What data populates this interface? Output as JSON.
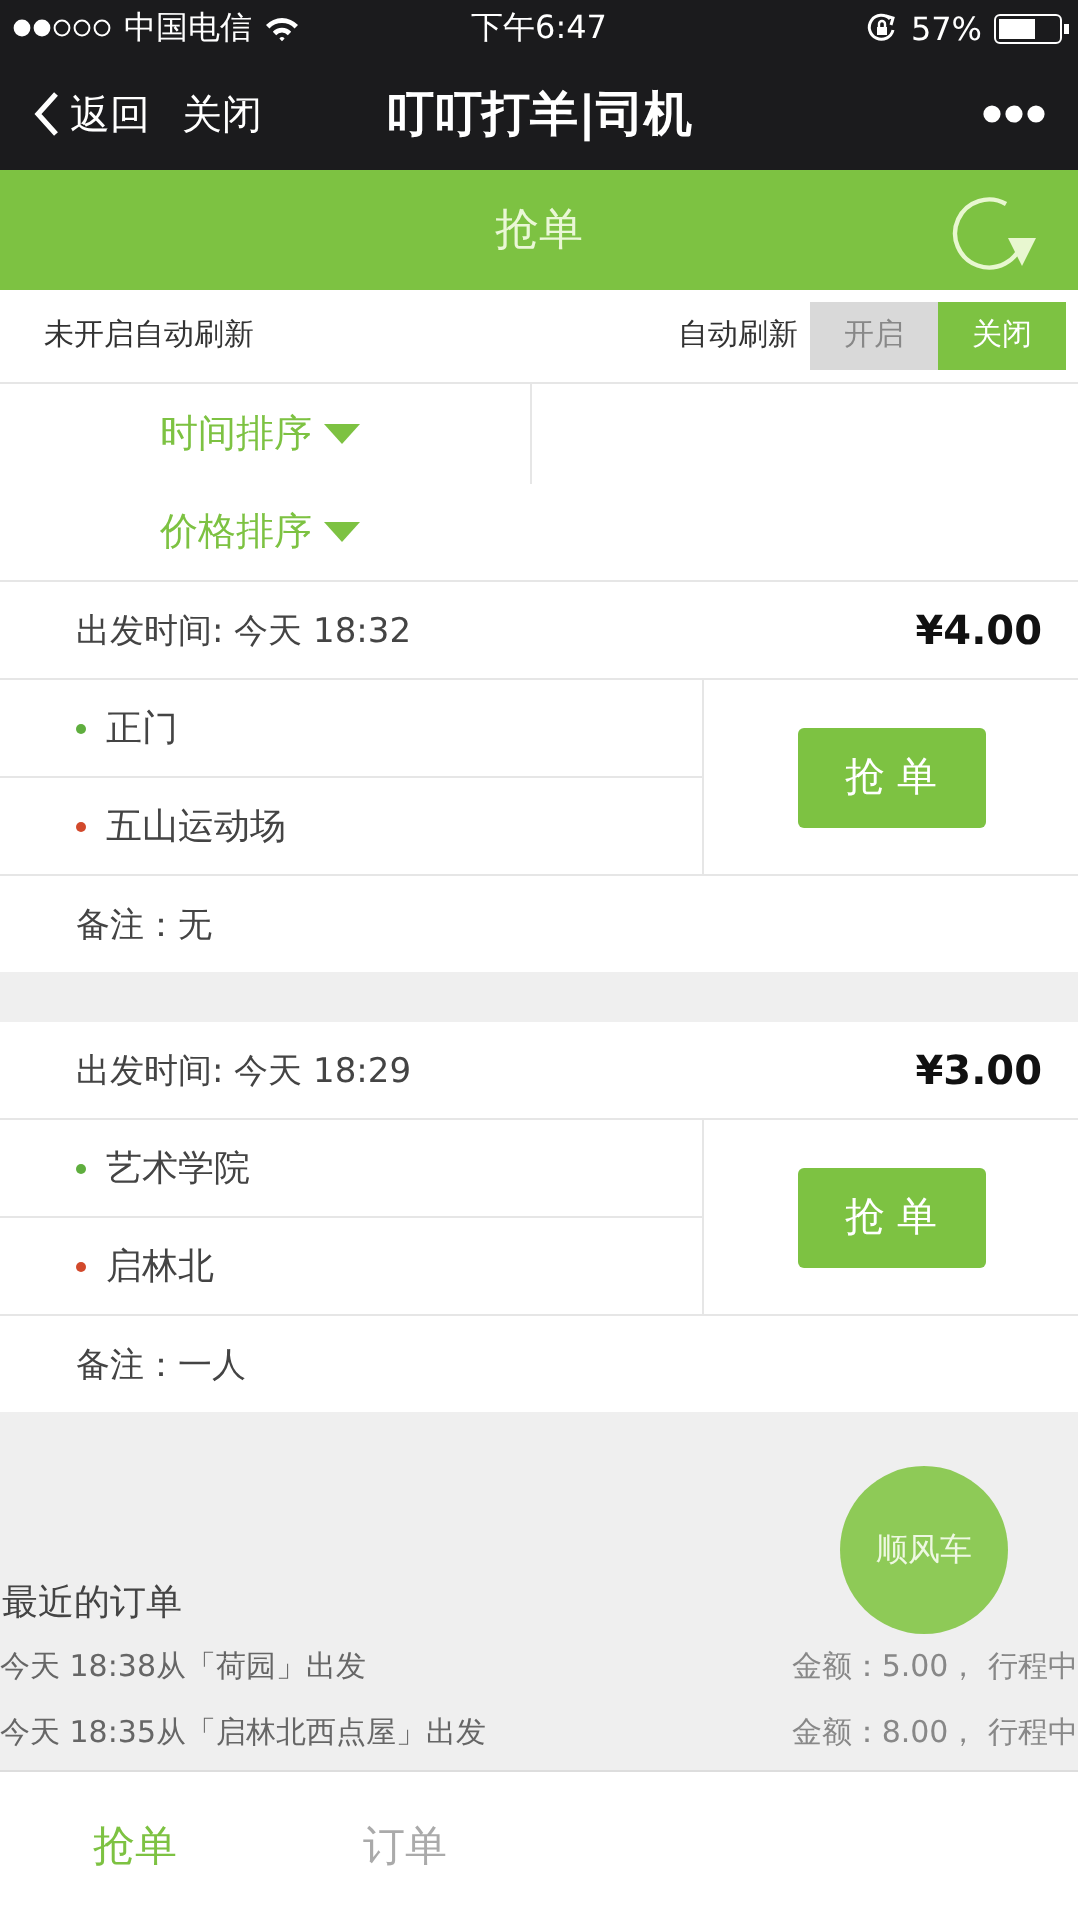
{
  "status_bar": {
    "carrier": "中国电信",
    "time": "下午6:47",
    "battery": "57%"
  },
  "nav": {
    "back": "返回",
    "close": "关闭",
    "title": "叮叮打羊|司机"
  },
  "header": {
    "title": "抢单"
  },
  "auto_refresh": {
    "status": "未开启自动刷新",
    "label": "自动刷新",
    "options": [
      {
        "label": "开启",
        "selected": false
      },
      {
        "label": "关闭",
        "selected": true
      }
    ]
  },
  "sorts": [
    {
      "label": "时间排序"
    },
    {
      "label": "价格排序"
    }
  ],
  "orders": [
    {
      "departure": "出发时间: 今天 18:32",
      "price": "¥4.00",
      "stops": [
        {
          "name": "正门",
          "color": "#5fae3e"
        },
        {
          "name": "五山运动场",
          "color": "#d2492c"
        }
      ],
      "button": "抢 单",
      "note": "备注：无"
    },
    {
      "departure": "出发时间: 今天 18:29",
      "price": "¥3.00",
      "stops": [
        {
          "name": "艺术学院",
          "color": "#5fae3e"
        },
        {
          "name": "启林北",
          "color": "#d2492c"
        }
      ],
      "button": "抢 单",
      "note": "备注：一人"
    }
  ],
  "recent": {
    "title": "最近的订单",
    "rows": [
      {
        "text": "今天 18:38从「荷园」出发",
        "amount": "金额：5.00， 行程中"
      },
      {
        "text": "今天 18:35从「启林北西点屋」出发",
        "amount": "金额：8.00， 行程中"
      }
    ]
  },
  "fab": {
    "label": "顺风车"
  },
  "tabs": [
    {
      "label": "抢单",
      "selected": true
    },
    {
      "label": "订单",
      "selected": false
    }
  ]
}
